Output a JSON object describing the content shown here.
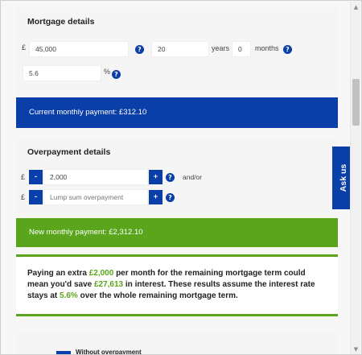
{
  "mortgage": {
    "heading": "Mortgage details",
    "currency_symbol": "£",
    "amount_value": "45,000",
    "years_value": "20",
    "years_label": "years",
    "months_value": "0",
    "months_label": "months",
    "rate_value": "5.6",
    "rate_unit": "%",
    "help_glyph": "?"
  },
  "current_payment": "Current monthly payment: £312.10",
  "overpayment": {
    "heading": "Overpayment details",
    "currency_symbol": "£",
    "monthly_value": "2,000",
    "lump_placeholder": "Lump sum overpayment",
    "minus_label": "-",
    "plus_label": "+",
    "andor_label": "and/or",
    "help_glyph": "?"
  },
  "ask_us": "Ask us",
  "new_payment": "New monthly payment: £2,312.10",
  "summary": {
    "p1": "Paying an extra ",
    "amount": "£2,000",
    "p2": " per month for the remaining mortgage term could mean you'd save ",
    "saving": "£27,613",
    "p3": " in interest. These results assume the interest rate stays at ",
    "rate": "5.6%",
    "p4": " over the whole remaining mortgage term."
  },
  "chart_legend": {
    "without_label": "Without overpayment"
  },
  "scrollbar": {
    "up_glyph": "▲",
    "down_glyph": "▼"
  },
  "colors": {
    "brand_blue": "#0a3ea8",
    "accent_green": "#5aa51c"
  }
}
